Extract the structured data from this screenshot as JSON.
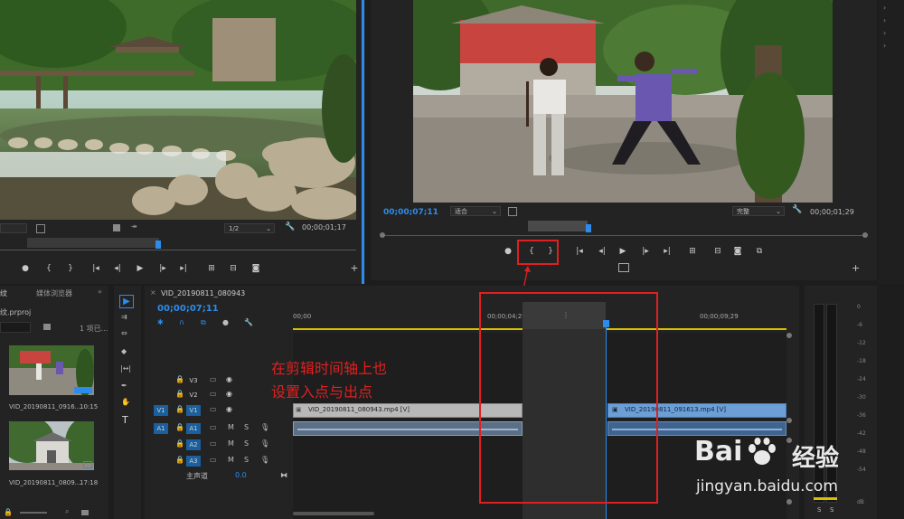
{
  "source_monitor": {
    "timecode": "00;00;01;17",
    "zoom": "1/2",
    "playhead": 0.35
  },
  "program_monitor": {
    "timecode_left": "00;00;07;11",
    "fit_label": "适合",
    "quality_label": "完整",
    "timecode_right": "00;00;01;29",
    "playhead": 0.51
  },
  "annotation": {
    "line1": "在剪辑时间轴上也",
    "line2": "设置入点与出点"
  },
  "project": {
    "tab_left": "纹",
    "tab_media": "媒体浏览器",
    "project_file": "纹.prproj",
    "item_count": "1 项已...",
    "clip1_name": "VID_20190811_0916...",
    "clip1_dur": "10:15",
    "clip2_name": "VID_20190811_0809...",
    "clip2_dur": "17:18"
  },
  "timeline": {
    "sequence_name": "VID_20190811_080943",
    "timecode": "00;00;07;11",
    "ruler": [
      "00;00",
      "00;00;04;29",
      "00;00;09;29"
    ],
    "tracks_video": [
      "V3",
      "V2",
      "V1"
    ],
    "tracks_audio": [
      "A1",
      "A2",
      "A3"
    ],
    "src_v": "V1",
    "src_a": "A1",
    "master_label": "主声道",
    "master_value": "0.0",
    "clip_left": "VID_20190811_080943.mp4 [V]",
    "clip_right": "VID_20190811_091613.mp4 [V]"
  },
  "meter": {
    "scale": [
      "0",
      "-6",
      "-12",
      "-18",
      "-24",
      "-30",
      "-36",
      "-42",
      "-48",
      "-54",
      "dB"
    ],
    "solo": [
      "S",
      "S"
    ]
  },
  "watermark": {
    "brand": "Bai",
    "brand_zh": "经验",
    "url": "jingyan.baidu.com"
  },
  "colors": {
    "accent": "#2d8ceb",
    "annotation_red": "#e02020",
    "video_clip": "#b8b8b8",
    "audio_clip": "#6c8fb8",
    "clip_right": "#6b9fd6"
  }
}
